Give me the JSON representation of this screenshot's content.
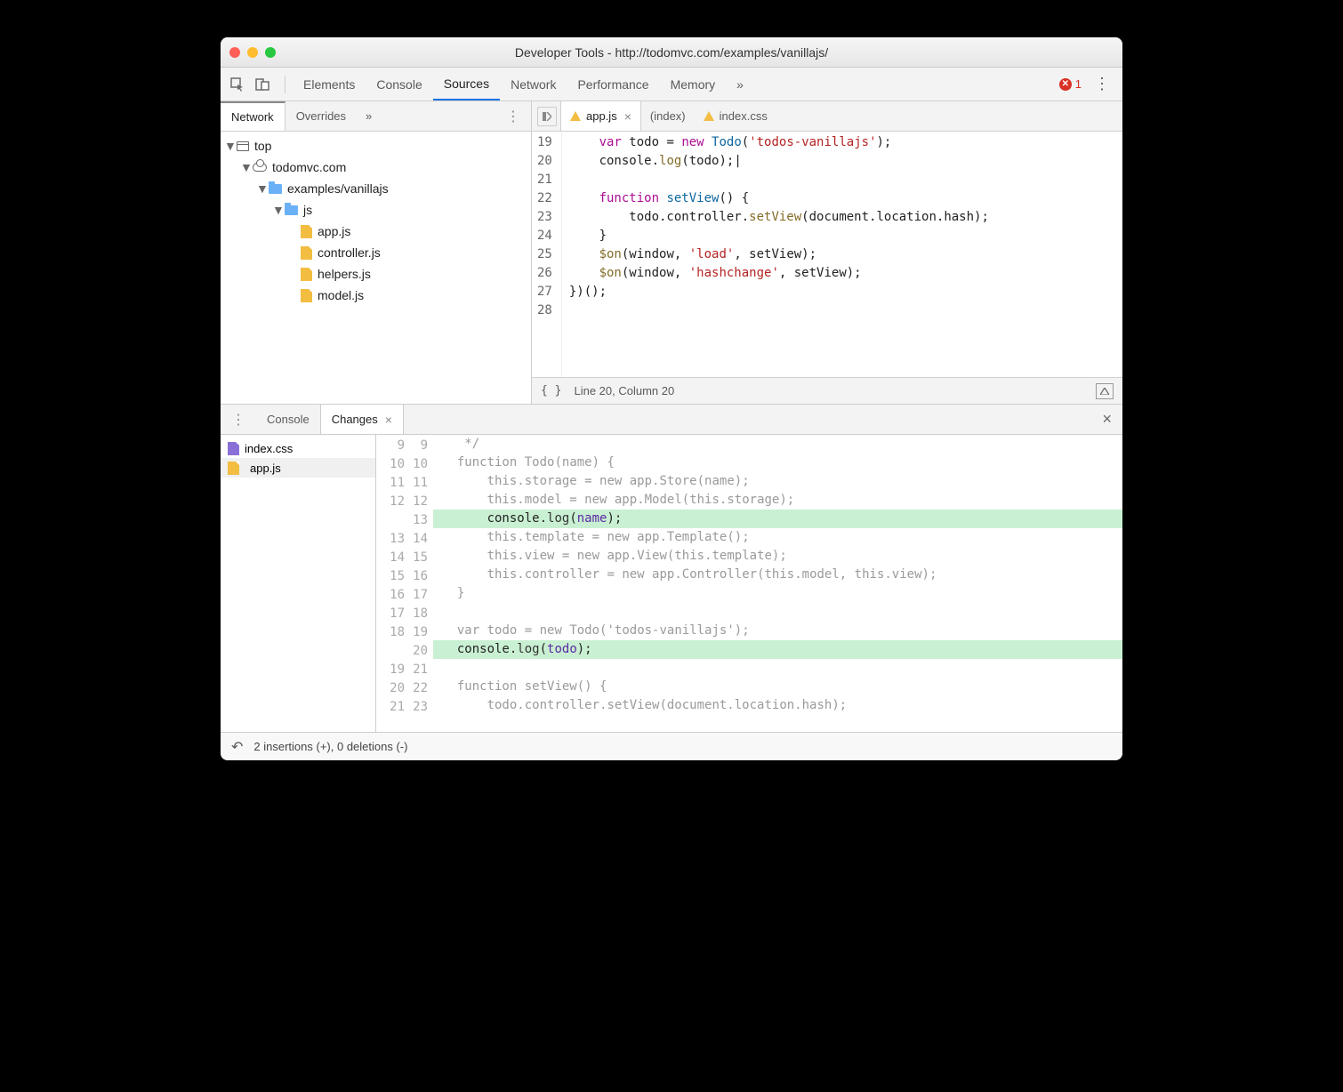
{
  "window": {
    "title": "Developer Tools - http://todomvc.com/examples/vanillajs/"
  },
  "toolbar": {
    "tabs": [
      "Elements",
      "Console",
      "Sources",
      "Network",
      "Performance",
      "Memory"
    ],
    "active": "Sources",
    "overflow": "»",
    "errorCount": "1"
  },
  "sidebar": {
    "tabs": {
      "network": "Network",
      "overrides": "Overrides",
      "overflow": "»"
    },
    "tree": {
      "top": "top",
      "domain": "todomvc.com",
      "folder1": "examples/vanillajs",
      "folder2": "js",
      "files": [
        "app.js",
        "controller.js",
        "helpers.js",
        "model.js"
      ]
    }
  },
  "editor": {
    "tabs": [
      {
        "label": "app.js",
        "warn": true,
        "active": true,
        "closable": true
      },
      {
        "label": "(index)",
        "warn": false,
        "active": false,
        "closable": false
      },
      {
        "label": "index.css",
        "warn": true,
        "active": false,
        "closable": false
      }
    ],
    "lines": {
      "19": {
        "n": "19",
        "html": "    <span class='kw'>var</span> todo = <span class='kw'>new</span> <span class='def'>Todo</span>(<span class='str'>'todos-vanillajs'</span>);"
      },
      "20": {
        "n": "20",
        "html": "    console.<span class='fn'>log</span>(todo);|"
      },
      "21": {
        "n": "21",
        "html": ""
      },
      "22": {
        "n": "22",
        "html": "    <span class='kw'>function</span> <span class='def'>setView</span>() {"
      },
      "23": {
        "n": "23",
        "html": "        todo.controller.<span class='fn'>setView</span>(document.location.hash);"
      },
      "24": {
        "n": "24",
        "html": "    }"
      },
      "25": {
        "n": "25",
        "html": "    <span class='fn'>$on</span>(window, <span class='str'>'load'</span>, setView);"
      },
      "26": {
        "n": "26",
        "html": "    <span class='fn'>$on</span>(window, <span class='str'>'hashchange'</span>, setView);"
      },
      "27": {
        "n": "27",
        "html": "})();"
      },
      "28": {
        "n": "28",
        "html": ""
      }
    },
    "status": "Line 20, Column 20",
    "braces": "{ }"
  },
  "drawer": {
    "tabConsole": "Console",
    "tabChanges": "Changes",
    "files": [
      {
        "name": "index.css",
        "type": "css"
      },
      {
        "name": "app.js",
        "type": "js",
        "selected": true
      }
    ],
    "diffLines": [
      {
        "l": "9",
        "r": "9",
        "cls": "dim",
        "html": "   */"
      },
      {
        "l": "10",
        "r": "10",
        "cls": "dim",
        "html": "  <span class='kw'>function</span> <span class='def'>Todo</span>(<span class='lit'>name</span>) {"
      },
      {
        "l": "11",
        "r": "11",
        "cls": "dim",
        "html": "      <span class='kw'>this</span>.storage = <span class='kw'>new</span> app.<span class='fn'>Store</span>(name);"
      },
      {
        "l": "12",
        "r": "12",
        "cls": "dim",
        "html": "      <span class='kw'>this</span>.model = <span class='kw'>new</span> app.<span class='fn'>Model</span>(<span class='kw'>this</span>.storage);"
      },
      {
        "l": "",
        "r": "13",
        "cls": "ins",
        "html": "      console.<span class='fn'>log</span>(<span class='lit'>name</span>);"
      },
      {
        "l": "13",
        "r": "14",
        "cls": "dim",
        "html": "      <span class='kw'>this</span>.template = <span class='kw'>new</span> app.<span class='fn'>Template</span>();"
      },
      {
        "l": "14",
        "r": "15",
        "cls": "dim",
        "html": "      <span class='kw'>this</span>.view = <span class='kw'>new</span> app.<span class='fn'>View</span>(<span class='kw'>this</span>.template);"
      },
      {
        "l": "15",
        "r": "16",
        "cls": "dim",
        "html": "      <span class='kw'>this</span>.controller = <span class='kw'>new</span> app.<span class='fn'>Controller</span>(<span class='kw'>this</span>.model, <span class='kw'>this</span>.view);"
      },
      {
        "l": "16",
        "r": "17",
        "cls": "dim",
        "html": "  }"
      },
      {
        "l": "17",
        "r": "18",
        "cls": "dim",
        "html": ""
      },
      {
        "l": "18",
        "r": "19",
        "cls": "dim",
        "html": "  <span class='kw'>var</span> todo = <span class='kw'>new</span> <span class='def'>Todo</span>(<span class='str'>'todos-vanillajs'</span>);"
      },
      {
        "l": "",
        "r": "20",
        "cls": "ins",
        "html": "  console.<span class='fn'>log</span>(<span class='lit'>todo</span>);"
      },
      {
        "l": "19",
        "r": "21",
        "cls": "dim",
        "html": ""
      },
      {
        "l": "20",
        "r": "22",
        "cls": "dim",
        "html": "  <span class='kw'>function</span> <span class='def'>setView</span>() {"
      },
      {
        "l": "21",
        "r": "23",
        "cls": "dim",
        "html": "      todo.controller.<span class='fn'>setView</span>(document.location.hash);"
      }
    ],
    "status": "2 insertions (+), 0 deletions (-)"
  }
}
